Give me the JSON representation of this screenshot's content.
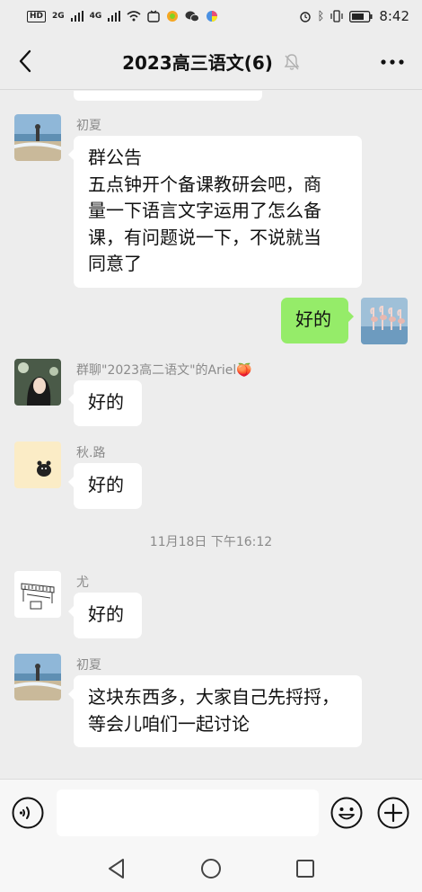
{
  "status_bar": {
    "hd": "HD",
    "net1": "2G",
    "net2": "4G",
    "time": "8:42",
    "icons": [
      "signal-icon",
      "wifi-icon",
      "alarm-icon",
      "bluetooth-icon",
      "vibrate-icon",
      "battery-icon"
    ]
  },
  "header": {
    "title": "2023高三语文(6)",
    "muted": true
  },
  "messages": [
    {
      "sender": "初夏",
      "avatar": "beach-photo",
      "text_lines": [
        "群公告",
        "五点钟开个备课教研会吧，商",
        "量一下语言文字运用了怎么备",
        "课，有问题说一下，不说就当",
        "同意了"
      ],
      "from_me": false
    },
    {
      "text": "好的",
      "avatar": "flamingo-photo",
      "from_me": true
    },
    {
      "sender": "群聊\"2023高二语文\"的Ariel🍑",
      "avatar": "girl-photo",
      "text": "好的",
      "from_me": false
    },
    {
      "sender": "秋.路",
      "avatar": "cartoon-bear",
      "text": "好的",
      "from_me": false
    },
    {
      "sender": "尤",
      "avatar": "piano-sketch",
      "text": "好的",
      "from_me": false
    },
    {
      "sender": "初夏",
      "avatar": "beach-photo",
      "text_lines": [
        "这块东西多，大家自己先捋捋，",
        "等会儿咱们一起讨论"
      ],
      "from_me": false
    }
  ],
  "time_separator": "11月18日 下午16:12",
  "input": {
    "value": "",
    "placeholder": ""
  },
  "colors": {
    "background": "#ededed",
    "bubble_other": "#ffffff",
    "bubble_me": "#95ec69",
    "sender_text": "#8a8a8a"
  }
}
